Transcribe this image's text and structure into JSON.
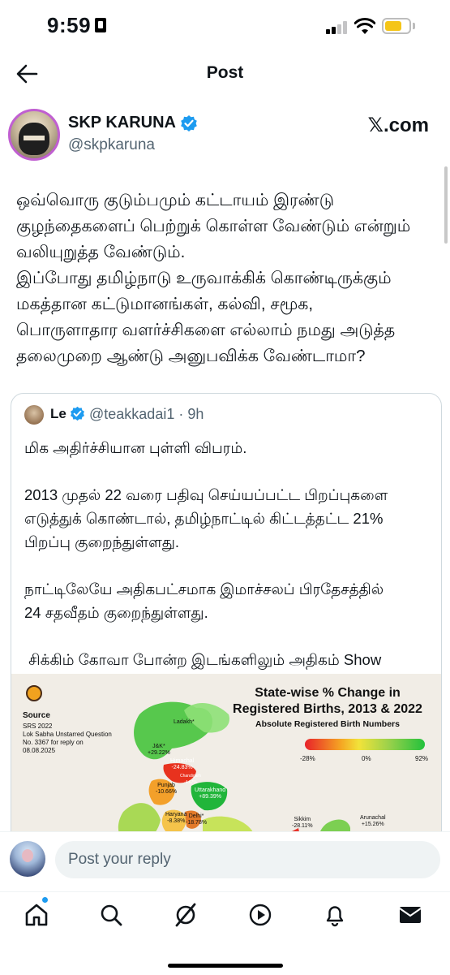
{
  "status": {
    "time": "9:59"
  },
  "nav": {
    "title": "Post"
  },
  "author": {
    "name": "SKP KARUNA",
    "handle": "@skpkaruna",
    "source": "𝕏.com"
  },
  "post": {
    "text": "ஒவ்வொரு குடும்பமும் கட்டாயம் இரண்டு\nகுழந்தைகளைப் பெற்றுக் கொள்ள வேண்டும் என்றும்\nவலியுறுத்த வேண்டும்.\nஇப்போது தமிழ்நாடு உருவாக்கிக் கொண்டிருக்கும்\nமகத்தான கட்டுமானங்கள், கல்வி, சமூக,\nபொருளாதார வளர்ச்சிகளை எல்லாம் நமது அடுத்த\nதலைமுறை ஆண்டு அனுபவிக்க வேண்டாமா?"
  },
  "quote": {
    "name": "Le",
    "handle": "@teakkadai1 · 9h",
    "text": "மிக அதிர்ச்சியான புள்ளி விபரம்.\n\n2013 முதல் 22 வரை பதிவு செய்யப்பட்ட பிறப்புகளை\nஎடுத்துக் கொண்டால், தமிழ்நாட்டில் கிட்டத்தட்ட 21%\nபிறப்பு குறைந்துள்ளது.\n\nநாட்டிலேயே அதிகபட்சமாக இமாச்சலப் பிரதேசத்தில்\n24 சதவீதம் குறைந்துள்ளது.\n\n சிக்கிம் கோவா போன்ற இடங்களிலும் அதிகம் Show\nmore",
    "map": {
      "source_title": "Source",
      "source_text": "SRS 2022\nLok Sabha Unstarred Question\nNo. 3367 for reply on\n08.08.2025",
      "title": "State-wise % Change in\nRegistered Births, 2013 & 2022",
      "subtitle": "Absolute Registered Birth Numbers",
      "scale": [
        "-28%",
        "0%",
        "92%"
      ],
      "regions": [
        {
          "name": "Ladakh*",
          "value": ""
        },
        {
          "name": "J&K*",
          "value": "+29.22%"
        },
        {
          "name": "Himachal",
          "value": "-24.83%"
        },
        {
          "name": "Chandigarh",
          "value": "-4.67%"
        },
        {
          "name": "Punjab",
          "value": "-10.66%"
        },
        {
          "name": "Uttarakhand",
          "value": "+89.39%"
        },
        {
          "name": "Haryana",
          "value": "-8.38%"
        },
        {
          "name": "Delhi*",
          "value": "-18.78%"
        },
        {
          "name": "Sikkim",
          "value": "-28.11%"
        },
        {
          "name": "Arunachal",
          "value": "+15.26%"
        }
      ]
    }
  },
  "reply": {
    "placeholder": "Post your reply"
  },
  "tabs": [
    "home",
    "search",
    "grok",
    "video",
    "notifications",
    "messages"
  ]
}
